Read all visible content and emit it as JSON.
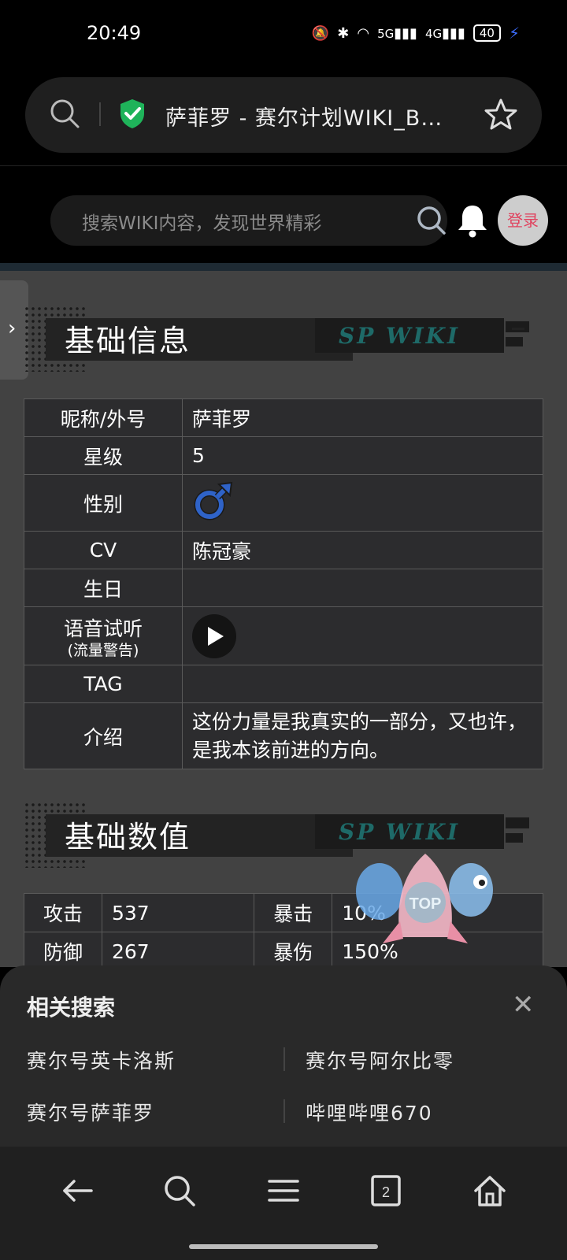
{
  "status_bar": {
    "time": "20:49",
    "network_5g": "5G",
    "network_4g": "4G",
    "battery": "40"
  },
  "browser": {
    "tab_title": "萨菲罗 - 赛尔计划WIKI_B…"
  },
  "site_header": {
    "search_placeholder": "搜索WIKI内容，发现世界精彩",
    "login_label": "登录"
  },
  "sections": {
    "basic_info_title": "基础信息",
    "basic_stats_title": "基础数值",
    "logo_text": "SP WIKI"
  },
  "basic_info": {
    "rows": [
      {
        "key": "昵称/外号",
        "value": "萨菲罗"
      },
      {
        "key": "星级",
        "value": "5"
      },
      {
        "key": "性别",
        "value": ""
      },
      {
        "key": "CV",
        "value": "陈冠豪"
      },
      {
        "key": "生日",
        "value": ""
      },
      {
        "key": "语音试听",
        "subkey": "(流量警告)",
        "value": ""
      },
      {
        "key": "TAG",
        "value": ""
      },
      {
        "key": "介绍",
        "value": "这份力量是我真实的一部分，又也许，是我本该前进的方向。"
      }
    ]
  },
  "basic_stats": {
    "rows": [
      {
        "k1": "攻击",
        "v1": "537",
        "k2": "暴击",
        "v2": "10%"
      },
      {
        "k1": "防御",
        "v1": "267",
        "k2": "暴伤",
        "v2": "150%"
      }
    ]
  },
  "top_button": {
    "label": "TOP"
  },
  "related": {
    "title": "相关搜索",
    "items": [
      "赛尔号英卡洛斯",
      "赛尔号阿尔比零",
      "赛尔号萨菲罗",
      "哔哩哔哩670"
    ]
  },
  "icons": {
    "gender": "male-symbol-icon",
    "play": "play-icon",
    "accent_red": "#e0435f",
    "shield_green": "#1fb35a"
  }
}
